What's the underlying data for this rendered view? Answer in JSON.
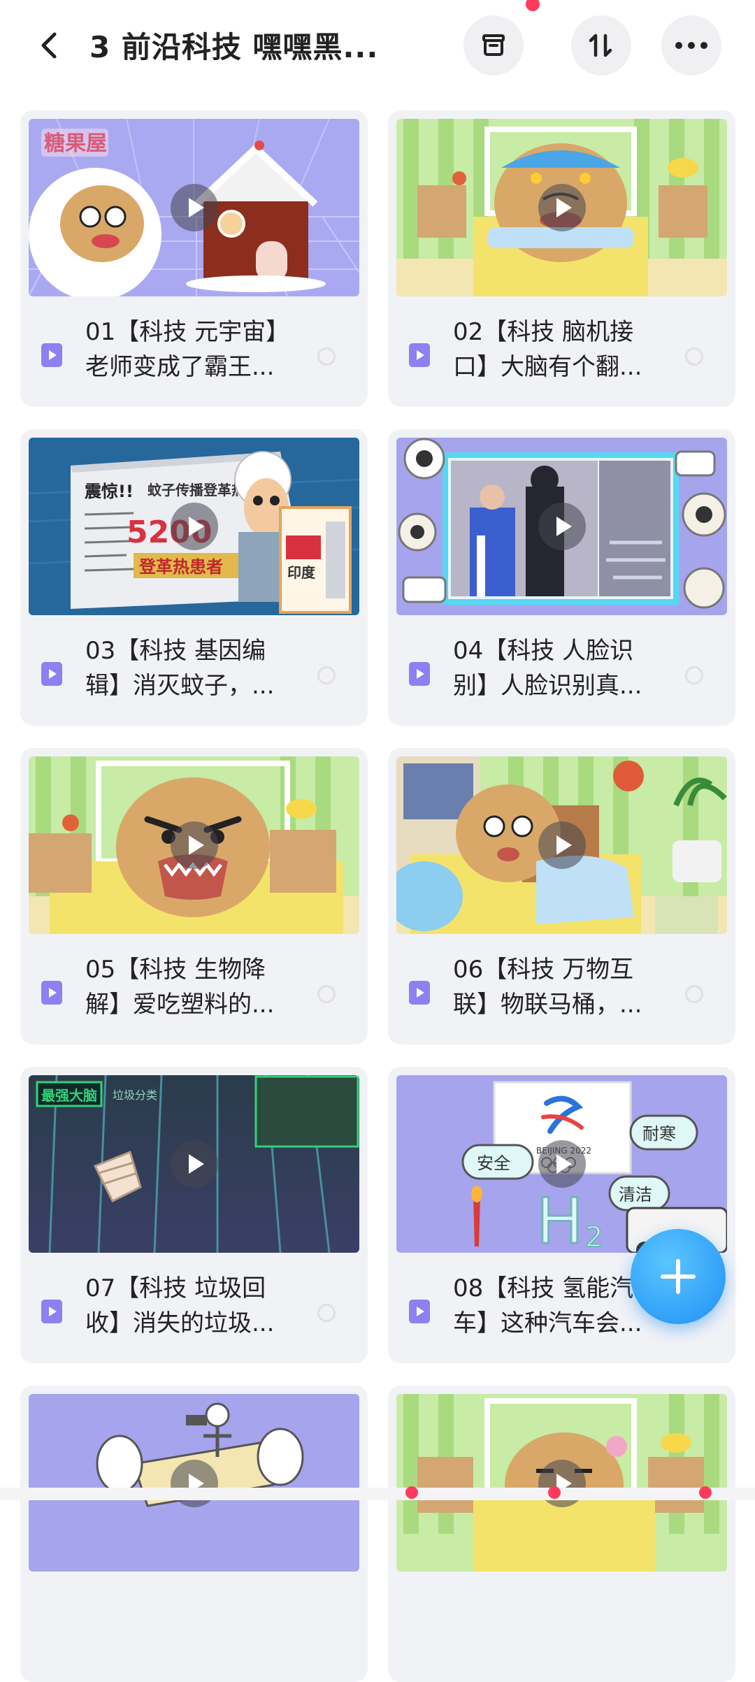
{
  "header": {
    "title": "3 前沿科技 嘿嘿黑...",
    "back_icon": "chevron-left-icon",
    "actions": [
      "archive-icon",
      "sort-icon",
      "more-icon"
    ]
  },
  "cards": [
    {
      "line1": "01【科技 元宇宙】",
      "line2": "老师变成了霸王..."
    },
    {
      "line1": "02【科技 脑机接",
      "line2": "口】大脑有个翻..."
    },
    {
      "line1": "03【科技 基因编",
      "line2": "辑】消灭蚊子，..."
    },
    {
      "line1": "04【科技 人脸识",
      "line2": "别】人脸识别真..."
    },
    {
      "line1": "05【科技 生物降",
      "line2": "解】爱吃塑料的..."
    },
    {
      "line1": "06【科技 万物互",
      "line2": "联】物联马桶，..."
    },
    {
      "line1": "07【科技 垃圾回",
      "line2": "收】消失的垃圾..."
    },
    {
      "line1": "08【科技 氢能汽",
      "line2": "车】这种汽车会..."
    }
  ],
  "thumb_text": {
    "t1_logo": "糖果屋",
    "t3_head": "震惊!!",
    "t3_sub": "蚊子传播登革热!",
    "t3_num": "5200",
    "t3_banner": "登革热患者",
    "t3_sign": "印度",
    "t7_tag": "最强大脑",
    "t7_sub": "垃圾分类",
    "t8_b1": "安全",
    "t8_b2": "耐寒",
    "t8_b3": "清洁",
    "t8_h2": "H",
    "t8_2": "2",
    "t8_olympic": "BEIJING 2022"
  },
  "colors": {
    "accent": "#8e7ff2",
    "fab": "#1e8ff5"
  }
}
